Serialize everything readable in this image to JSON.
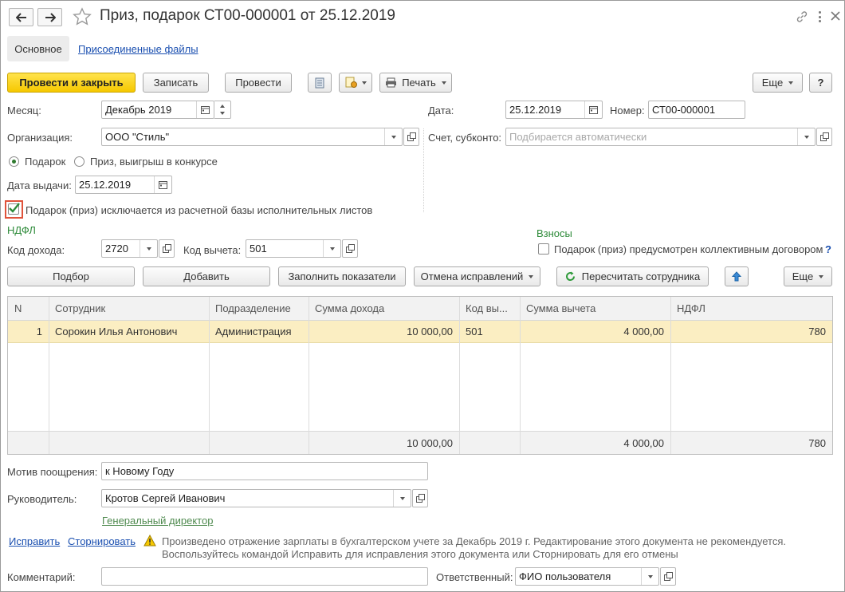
{
  "window": {
    "title": "Приз, подарок СТ00-000001 от 25.12.2019"
  },
  "tabs": {
    "main": "Основное",
    "files": "Присоединенные файлы"
  },
  "toolbar": {
    "post_close": "Провести и закрыть",
    "save": "Записать",
    "post": "Провести",
    "print": "Печать",
    "more": "Еще",
    "help": "?"
  },
  "fields": {
    "month_label": "Месяц:",
    "month_value": "Декабрь 2019",
    "date_label": "Дата:",
    "date_value": "25.12.2019",
    "number_label": "Номер:",
    "number_value": "СТ00-000001",
    "org_label": "Организация:",
    "org_value": "ООО \"Стиль\"",
    "account_label": "Счет, субконто:",
    "account_placeholder": "Подбирается автоматически",
    "radio_gift": "Подарок",
    "radio_prize": "Приз, выигрыш в конкурсе",
    "issue_date_label": "Дата выдачи:",
    "issue_date_value": "25.12.2019",
    "exclude_checkbox": "Подарок (приз) исключается из расчетной базы исполнительных листов"
  },
  "ndfl": {
    "section": "НДФЛ",
    "income_code_label": "Код дохода:",
    "income_code_value": "2720",
    "deduction_code_label": "Код вычета:",
    "deduction_code_value": "501"
  },
  "contributions": {
    "section": "Взносы",
    "collective_checkbox": "Подарок (приз) предусмотрен коллективным договором",
    "help": "?"
  },
  "table_toolbar": {
    "pick": "Подбор",
    "add": "Добавить",
    "fill": "Заполнить показатели",
    "cancel_fix": "Отмена исправлений",
    "recalc": "Пересчитать сотрудника",
    "more": "Еще"
  },
  "table": {
    "columns": [
      "N",
      "Сотрудник",
      "Подразделение",
      "Сумма дохода",
      "Код вы...",
      "Сумма вычета",
      "НДФЛ"
    ],
    "rows": [
      {
        "n": "1",
        "employee": "Сорокин Илья Антонович",
        "department": "Администрация",
        "income": "10 000,00",
        "code": "501",
        "deduction": "4 000,00",
        "ndfl": "780"
      }
    ],
    "totals": {
      "income": "10 000,00",
      "deduction": "4 000,00",
      "ndfl": "780"
    }
  },
  "footer": {
    "motive_label": "Мотив поощрения:",
    "motive_value": "к Новому Году",
    "manager_label": "Руководитель:",
    "manager_value": "Кротов Сергей Иванович",
    "manager_position": "Генеральный директор",
    "fix_link": "Исправить",
    "storno_link": "Сторнировать",
    "warning_line1": "Произведено отражение зарплаты в бухгалтерском учете за Декабрь 2019 г. Редактирование этого документа не рекомендуется.",
    "warning_line2": "Воспользуйтесь командой Исправить для исправления этого документа или Сторнировать для его отмены",
    "comment_label": "Комментарий:",
    "comment_value": "",
    "responsible_label": "Ответственный:",
    "responsible_value": "ФИО пользователя"
  },
  "colors": {
    "primary_button": "#f6c800",
    "section_green": "#2e8b3a",
    "selected_row": "#fbeec2",
    "link": "#1a4fb0",
    "highlight_border": "#e0533b"
  }
}
